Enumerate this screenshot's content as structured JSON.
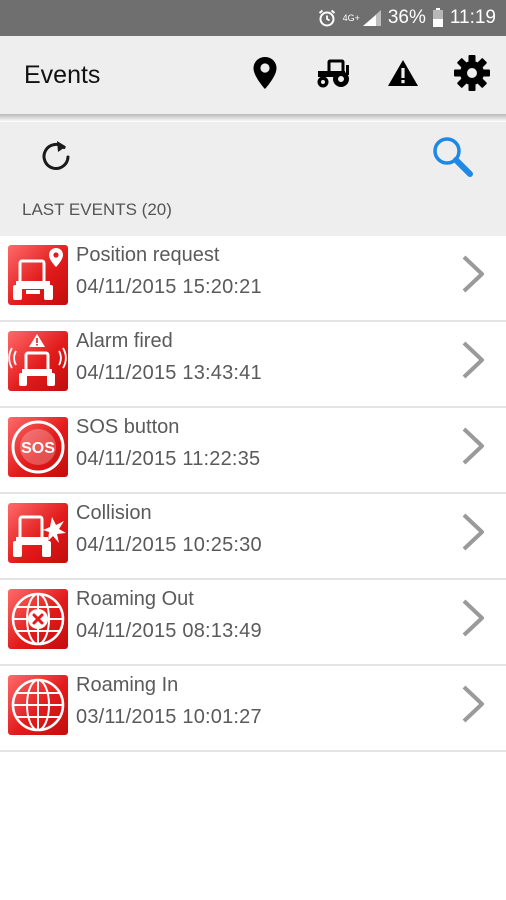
{
  "status_bar": {
    "network": "4G+",
    "battery": "36%",
    "time": "11:19",
    "icons": [
      "alarm-icon",
      "network-icon",
      "signal-icon",
      "battery-icon"
    ]
  },
  "app_bar": {
    "title": "Events",
    "actions": [
      "map-pin-icon",
      "tractor-icon",
      "warning-icon",
      "gear-icon"
    ]
  },
  "toolbar": {
    "icons": [
      "refresh-icon",
      "search-icon"
    ]
  },
  "section": {
    "header": "LAST EVENTS (20)"
  },
  "colors": {
    "accent": "#1e88e5",
    "event_icon_red": "#e21b1b",
    "text": "#5a5a5a",
    "background": "#eeeeee"
  },
  "events": [
    {
      "title": "Position request",
      "datetime": "04/11/2015 15:20:21",
      "icon": "tractor-location-icon"
    },
    {
      "title": "Alarm fired",
      "datetime": "04/11/2015 13:43:41",
      "icon": "tractor-alarm-icon"
    },
    {
      "title": "SOS button",
      "datetime": "04/11/2015 11:22:35",
      "icon": "sos-icon"
    },
    {
      "title": "Collision",
      "datetime": "04/11/2015 10:25:30",
      "icon": "tractor-collision-icon"
    },
    {
      "title": "Roaming Out",
      "datetime": "04/11/2015 08:13:49",
      "icon": "globe-cross-icon"
    },
    {
      "title": "Roaming In",
      "datetime": "03/11/2015 10:01:27",
      "icon": "globe-icon"
    }
  ]
}
